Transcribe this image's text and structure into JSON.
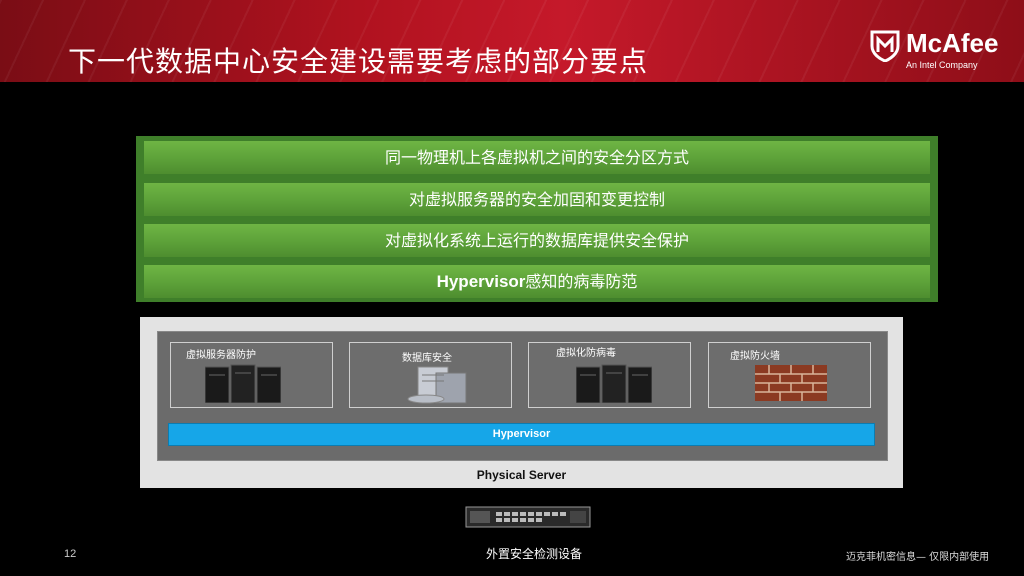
{
  "slide": {
    "title": "下一代数据中心安全建设需要考虑的部分要点",
    "page_number": "12",
    "footer_center": "外置安全检测设备",
    "footer_right": "迈克菲机密信息— 仅限内部使用"
  },
  "logo": {
    "name": "McAfee",
    "subtitle": "An Intel Company"
  },
  "bars": [
    {
      "text": "同一物理机上各虚拟机之间的安全分区方式"
    },
    {
      "text": "对虚拟服务器的安全加固和变更控制"
    },
    {
      "text": "对虚拟化系统上运行的数据库提供安全保护"
    },
    {
      "bold": "Hypervisor",
      "text": "感知的病毒防范"
    }
  ],
  "diagram": {
    "components": [
      {
        "label": "虚拟服务器防护",
        "icon": "server-rack-icon"
      },
      {
        "label": "数据库安全",
        "icon": "database-server-icon"
      },
      {
        "label": "虚拟化防病毒",
        "icon": "server-rack-icon"
      },
      {
        "label": "虚拟防火墙",
        "icon": "firewall-wall-icon"
      }
    ],
    "hypervisor_label": "Hypervisor",
    "physical_server_label": "Physical Server"
  },
  "colors": {
    "header_red": "#b0121f",
    "bar_green": "#5ea33a",
    "hypervisor_blue": "#16a6e8"
  }
}
